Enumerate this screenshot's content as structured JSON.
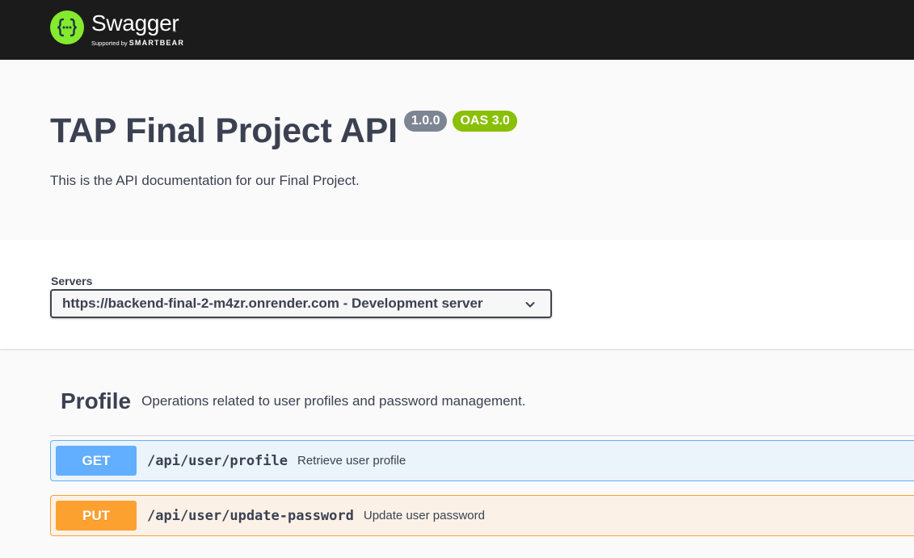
{
  "topbar": {
    "brand_name": "Swagger",
    "brand_tm": "™",
    "supported_by": "Supported by",
    "supported_brand": "SMARTBEAR",
    "logo_icon": "swagger-braces-icon",
    "colors": {
      "background": "#1b1b1b",
      "logo": "#85ea2d"
    }
  },
  "info": {
    "title": "TAP Final Project API",
    "version": "1.0.0",
    "oas": "OAS 3.0",
    "description": "This is the API documentation for our Final Project."
  },
  "servers": {
    "label": "Servers",
    "selected": "https://backend-final-2-m4zr.onrender.com - Development server",
    "icon": "chevron-down-icon"
  },
  "tags": [
    {
      "name": "Profile",
      "description": "Operations related to user profiles and password management.",
      "operations": [
        {
          "method": "GET",
          "path": "/api/user/profile",
          "summary": "Retrieve user profile",
          "color": "#61affe"
        },
        {
          "method": "PUT",
          "path": "/api/user/update-password",
          "summary": "Update user password",
          "color": "#fca130"
        }
      ]
    }
  ]
}
